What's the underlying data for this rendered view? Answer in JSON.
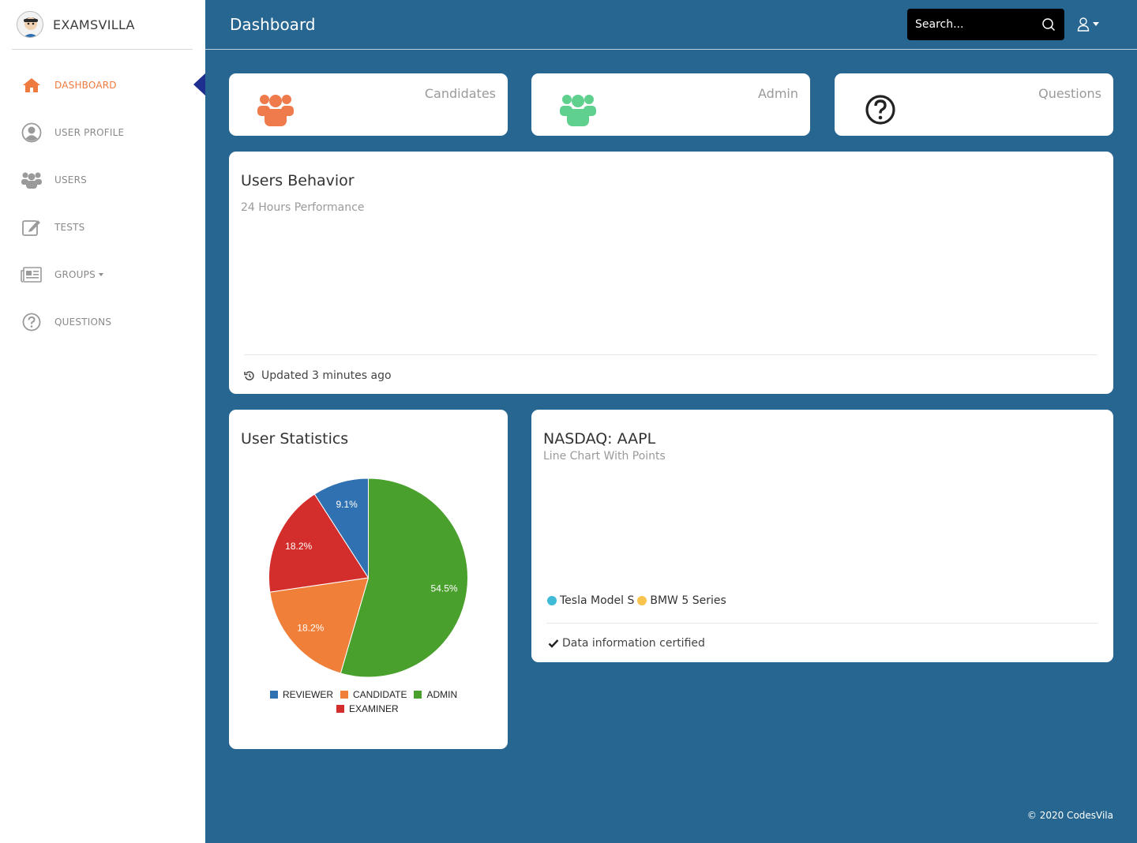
{
  "brand": {
    "name": "EXAMSVILLA"
  },
  "sidebar": {
    "items": [
      {
        "label": "DASHBOARD",
        "icon": "home-icon",
        "active": true
      },
      {
        "label": "USER PROFILE",
        "icon": "user-circle-icon"
      },
      {
        "label": "USERS",
        "icon": "users-icon"
      },
      {
        "label": "TESTS",
        "icon": "edit-icon"
      },
      {
        "label": "GROUPS",
        "icon": "newspaper-icon",
        "has_dropdown": true
      },
      {
        "label": "QUESTIONS",
        "icon": "question-circle-icon"
      }
    ]
  },
  "header": {
    "title": "Dashboard",
    "search_placeholder": "Search..."
  },
  "stats": [
    {
      "label": "Candidates",
      "icon": "users-icon",
      "color": "#ef7a4c"
    },
    {
      "label": "Admin",
      "icon": "users-icon",
      "color": "#5fd08e"
    },
    {
      "label": "Questions",
      "icon": "question-circle-icon",
      "color": "#222222"
    }
  ],
  "behavior": {
    "title": "Users Behavior",
    "subtitle": "24 Hours Performance",
    "footer": "Updated 3 minutes ago"
  },
  "user_stats": {
    "title": "User Statistics"
  },
  "chart_data": {
    "type": "pie",
    "title": "User Statistics",
    "categories": [
      "REVIEWER",
      "CANDIDATE",
      "ADMIN",
      "EXAMINER"
    ],
    "values": [
      9.1,
      18.2,
      54.5,
      18.2
    ],
    "labels": [
      "9.1%",
      "18.2%",
      "54.5%",
      "18.2%"
    ],
    "colors": [
      "#3071b2",
      "#f07f3a",
      "#4aa02c",
      "#d42e2c"
    ],
    "legend": "bottom"
  },
  "nasdaq": {
    "title": "NASDAQ: AAPL",
    "subtitle": "Line Chart With Points",
    "legend": [
      {
        "name": "Tesla Model S",
        "color": "#3fbbd8"
      },
      {
        "name": "BMW 5 Series",
        "color": "#f9c44d"
      }
    ],
    "footer": "Data information certified"
  },
  "footer": {
    "copyright": "© 2020 CodesVila"
  }
}
